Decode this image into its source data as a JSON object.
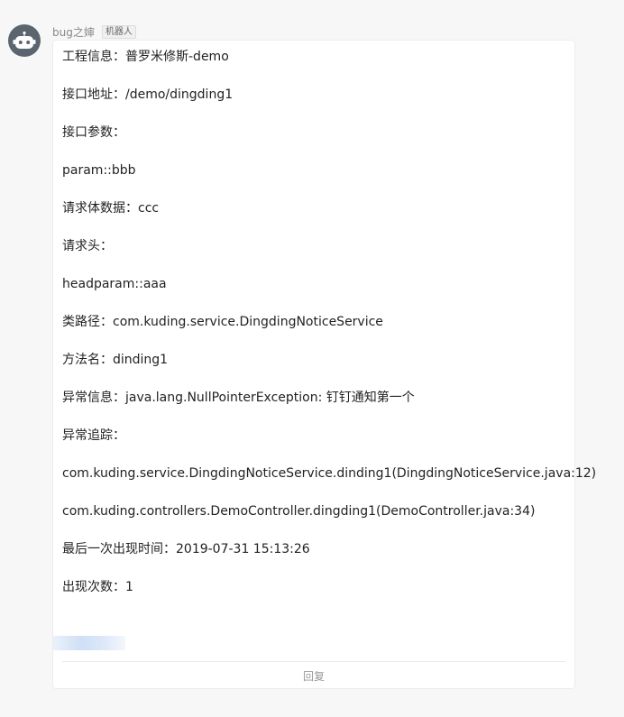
{
  "message": {
    "sender_name": "bug之婶",
    "sender_badge": "机器人",
    "avatar_icon": "robot-icon",
    "lines": [
      "工程信息：普罗米修斯-demo",
      "接口地址：/demo/dingding1",
      "接口参数：",
      "param::bbb",
      "请求体数据：ccc",
      "请求头：",
      "headparam::aaa",
      "类路径：com.kuding.service.DingdingNoticeService",
      "方法名：dinding1",
      "异常信息：java.lang.NullPointerException: 钉钉通知第一个",
      "异常追踪：",
      "com.kuding.service.DingdingNoticeService.dinding1(DingdingNoticeService.java:12)",
      "com.kuding.controllers.DemoController.dingding1(DemoController.java:34)",
      "最后一次出现时间：2019-07-31 15:13:26",
      "出现次数：1"
    ],
    "reply_label": "回复"
  }
}
